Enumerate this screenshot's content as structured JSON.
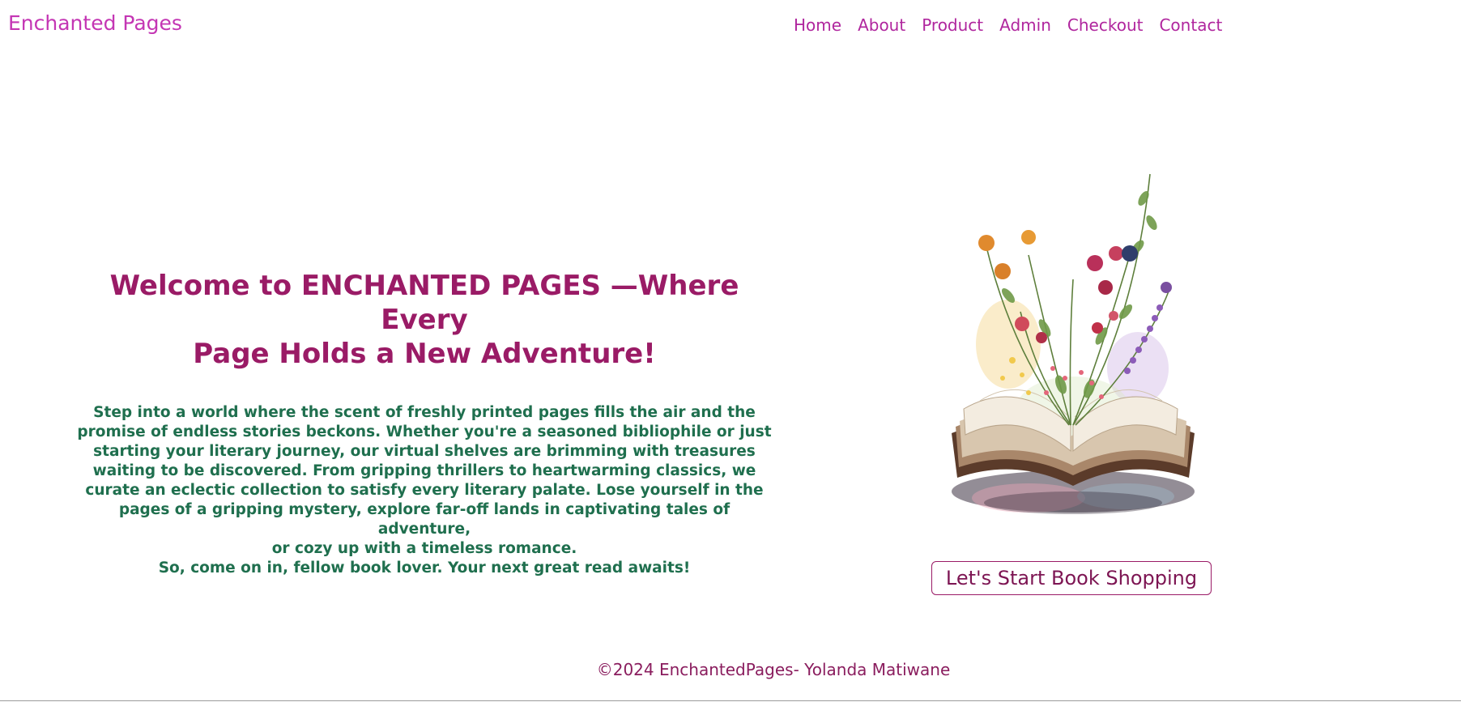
{
  "header": {
    "brand": "Enchanted Pages",
    "nav": [
      "Home",
      "About",
      "Product",
      "Admin",
      "Checkout",
      "Contact"
    ]
  },
  "hero": {
    "title_line1": "Welcome to ENCHANTED PAGES —Where Every",
    "title_line2": "Page Holds a New Adventure!",
    "body": [
      "Step into a world where the scent of freshly printed pages fills the air and the",
      "promise of endless stories beckons. Whether you're a seasoned bibliophile or just",
      "starting your literary journey, our virtual shelves are brimming with treasures",
      "waiting to be discovered. From gripping thrillers to heartwarming classics, we",
      "curate an eclectic collection to satisfy every literary palate. Lose yourself in the",
      "pages of a gripping mystery, explore far-off lands in captivating tales of adventure,",
      "or cozy up with a timeless romance.",
      "So, come on in, fellow book lover. Your next great read awaits!"
    ],
    "cta_label": "Let's Start Book Shopping"
  },
  "footer": {
    "text": "©2024 EnchantedPages- Yolanda Matiwane"
  },
  "icons": {
    "hero_image": "open-book-with-flowers-illustration"
  },
  "colors": {
    "brand": "#c436b4",
    "heading": "#9a1b66",
    "body_text": "#1f6f4e",
    "footer": "#8a1d5e"
  }
}
